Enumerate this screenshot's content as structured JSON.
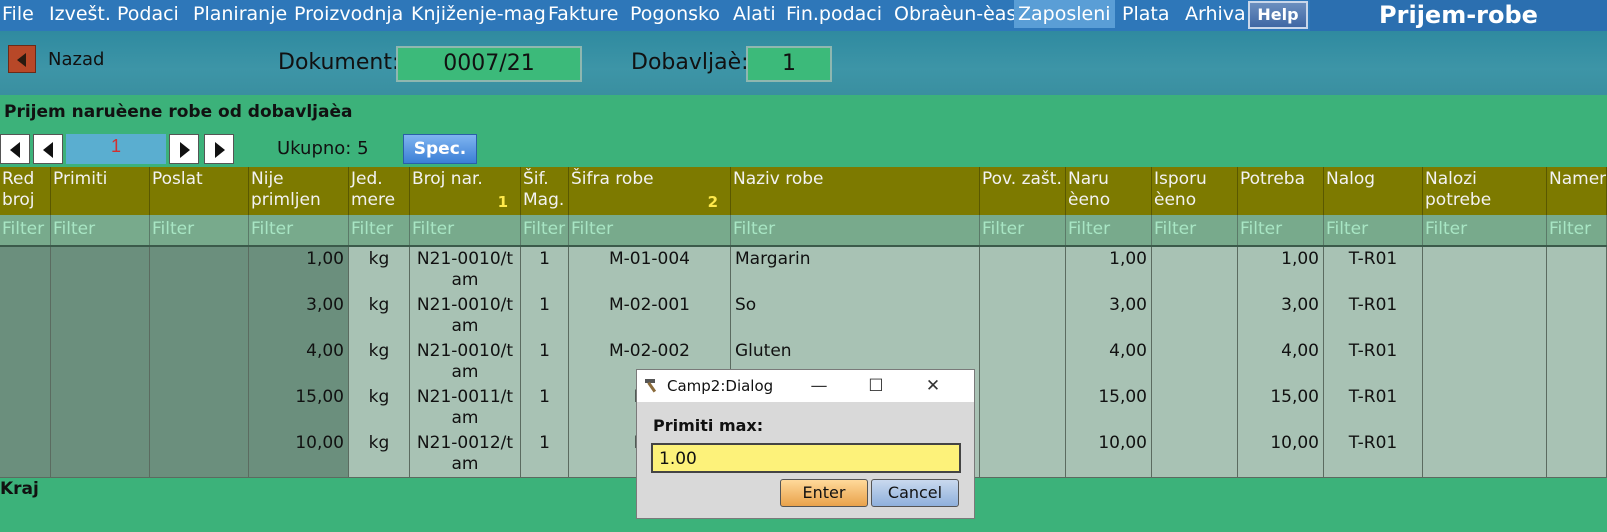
{
  "menu": [
    "File",
    "Izvešt.",
    "Podaci",
    "Planiranje",
    "Proizvodnja",
    "Knjiženje-mag",
    "Fakture",
    "Pogonsko",
    "Alati",
    "Fin.podaci",
    "Obraèun-èas",
    "Zaposleni",
    "Plata",
    "Arhiva"
  ],
  "help_label": "Help",
  "window_title": "Prijem-robe",
  "toolbar": {
    "back_label": "Nazad",
    "document_label": "Dokument:",
    "document_value": "0007/21",
    "supplier_label": "Dobavljaè:",
    "supplier_value": "1"
  },
  "section_title": "Prijem naruèene robe od dobavljaèa",
  "pager": {
    "page": "1",
    "total_label": "Ukupno: 5",
    "spec_label": "Spec."
  },
  "columns": [
    {
      "label": "Red broj"
    },
    {
      "label": "Primiti"
    },
    {
      "label": "Poslat"
    },
    {
      "label": "Nije primljen"
    },
    {
      "label": "Jed. mere"
    },
    {
      "label": "Broj nar.",
      "sort": "1"
    },
    {
      "label": "Šif. Mag."
    },
    {
      "label": "Šifra robe",
      "sort": "2"
    },
    {
      "label": "Naziv robe"
    },
    {
      "label": "Pov. zašt."
    },
    {
      "label": "Naru èeno"
    },
    {
      "label": "Isporu èeno"
    },
    {
      "label": "Potreba"
    },
    {
      "label": "Nalog"
    },
    {
      "label": "Nalozi potrebe"
    },
    {
      "label": "Namena"
    }
  ],
  "filter_placeholder": "Filter",
  "rows": [
    [
      "",
      "",
      "",
      "1,00",
      "kg",
      "N21-0010/tam",
      "1",
      "M-01-004",
      "Margarin",
      "",
      "1,00",
      "",
      "1,00",
      "T-R01",
      "",
      ""
    ],
    [
      "",
      "",
      "",
      "3,00",
      "kg",
      "N21-0010/tam",
      "1",
      "M-02-001",
      "So",
      "",
      "3,00",
      "",
      "3,00",
      "T-R01",
      "",
      ""
    ],
    [
      "",
      "",
      "",
      "4,00",
      "kg",
      "N21-0010/tam",
      "1",
      "M-02-002",
      "Gluten",
      "",
      "4,00",
      "",
      "4,00",
      "T-R01",
      "",
      ""
    ],
    [
      "",
      "",
      "",
      "15,00",
      "kg",
      "N21-0011/tam",
      "1",
      "M-0",
      "",
      "",
      "15,00",
      "",
      "15,00",
      "T-R01",
      "",
      ""
    ],
    [
      "",
      "",
      "",
      "10,00",
      "kg",
      "N21-0012/tam",
      "1",
      "M-0",
      "",
      "",
      "10,00",
      "",
      "10,00",
      "T-R01",
      "",
      ""
    ]
  ],
  "footer_label": "Kraj",
  "dialog": {
    "title": "Camp2:Dialog",
    "label": "Primiti max:",
    "value": "1.00",
    "enter_label": "Enter",
    "cancel_label": "Cancel"
  }
}
